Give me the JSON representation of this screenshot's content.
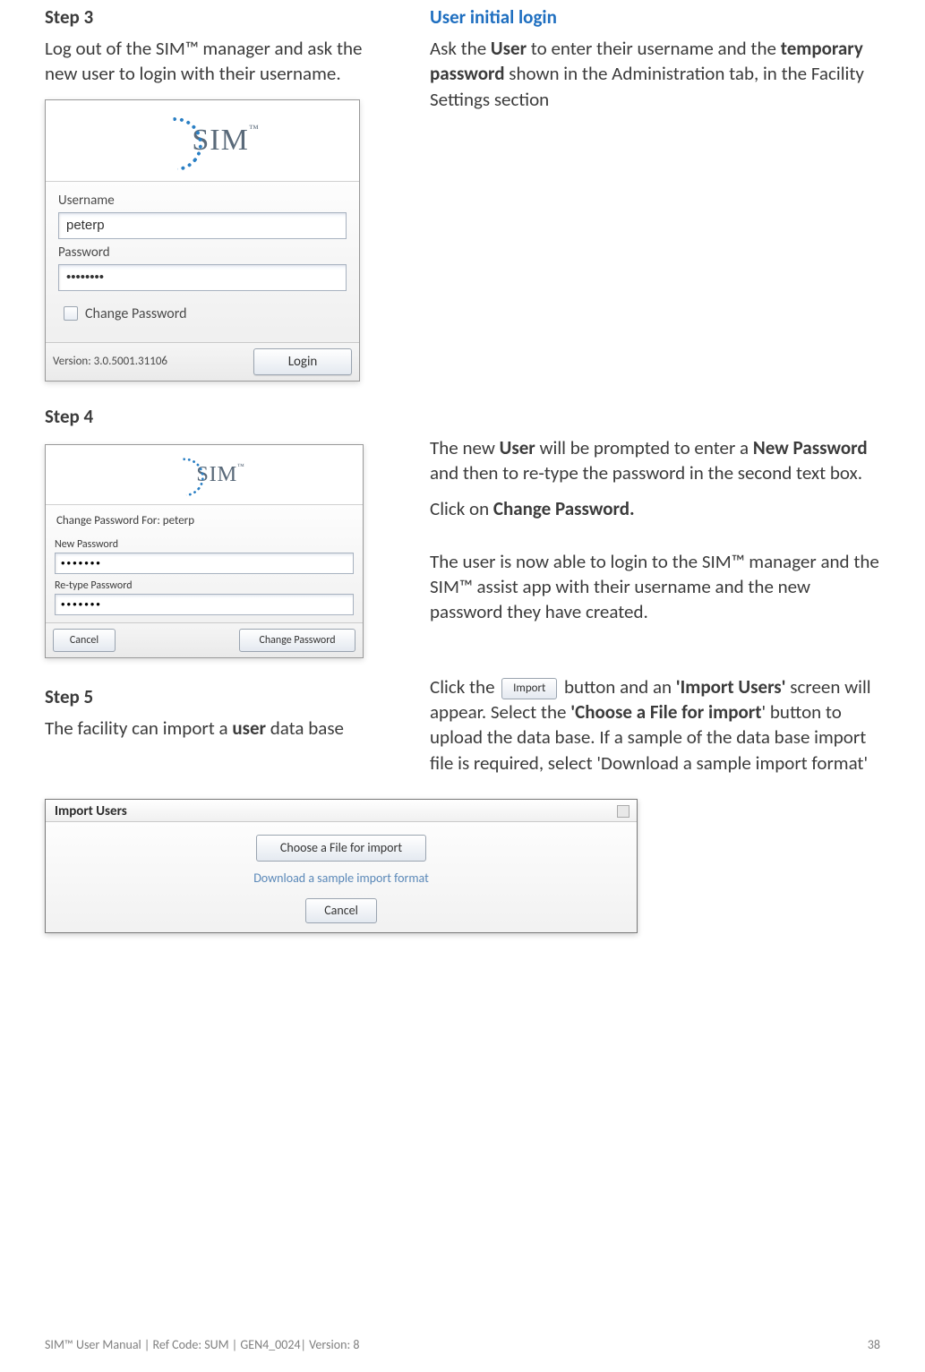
{
  "step3": {
    "heading": "Step 3",
    "text_pre": "Log out of the SIM™ manager and ask the new user to login with their username."
  },
  "login_dialog": {
    "logo_text": "SIM",
    "tm": "™",
    "username_label": "Username",
    "username_value": "peterp",
    "password_label": "Password",
    "password_value": "••••••••",
    "change_pw_label": "Change Password",
    "login_btn": "Login",
    "version": "Version: 3.0.5001.31106"
  },
  "user_initial_login": {
    "heading": "User initial login",
    "p1_a": "Ask the ",
    "p1_b": "User",
    "p1_c": " to enter their username and the ",
    "p1_d": "temporary password",
    "p1_e": " shown in the Administration tab, in the Facility Settings section"
  },
  "step4": {
    "heading": "Step 4",
    "cp_header_pre": "Change Password For:  ",
    "cp_header_user": "peterp",
    "new_pw_label": "New Password",
    "new_pw_value": "•••••••",
    "retype_label": "Re-type Password",
    "retype_value": "•••••••",
    "cancel_btn": "Cancel",
    "change_btn": "Change Password",
    "right_p1_a": "The new ",
    "right_p1_b": "User",
    "right_p1_c": " will be prompted to enter a ",
    "right_p1_d": "New Password",
    "right_p1_e": " and then to re-type the password in the second text box.",
    "right_p2_a": "Click on ",
    "right_p2_b": "Change Password.",
    "right_p3": "The user is now able to login to the SIM™ manager and the SIM™ assist app with their username and the new password they have created."
  },
  "step5": {
    "heading": "Step 5",
    "left_p_a": "The facility can import a ",
    "left_p_b": "user",
    "left_p_c": " data base",
    "right_p_a": "Click the ",
    "import_btn_label": "Import",
    "right_p_b": " button and an ",
    "right_p_c": "'Import Users'",
    "right_p_d": " screen will appear. Select the ",
    "right_p_e": "'Choose a File for import",
    "right_p_f": "' button to upload the data base. If a sample of the data base import file is required, select 'Download a sample import format'"
  },
  "import_dialog": {
    "title": "Import Users",
    "choose_btn": "Choose a File for import",
    "download_link": "Download a sample import format",
    "cancel_btn": "Cancel"
  },
  "footer": {
    "left": "SIM™ User Manual | Ref Code: SUM | GEN4_0024| Version: 8",
    "page": "38"
  }
}
